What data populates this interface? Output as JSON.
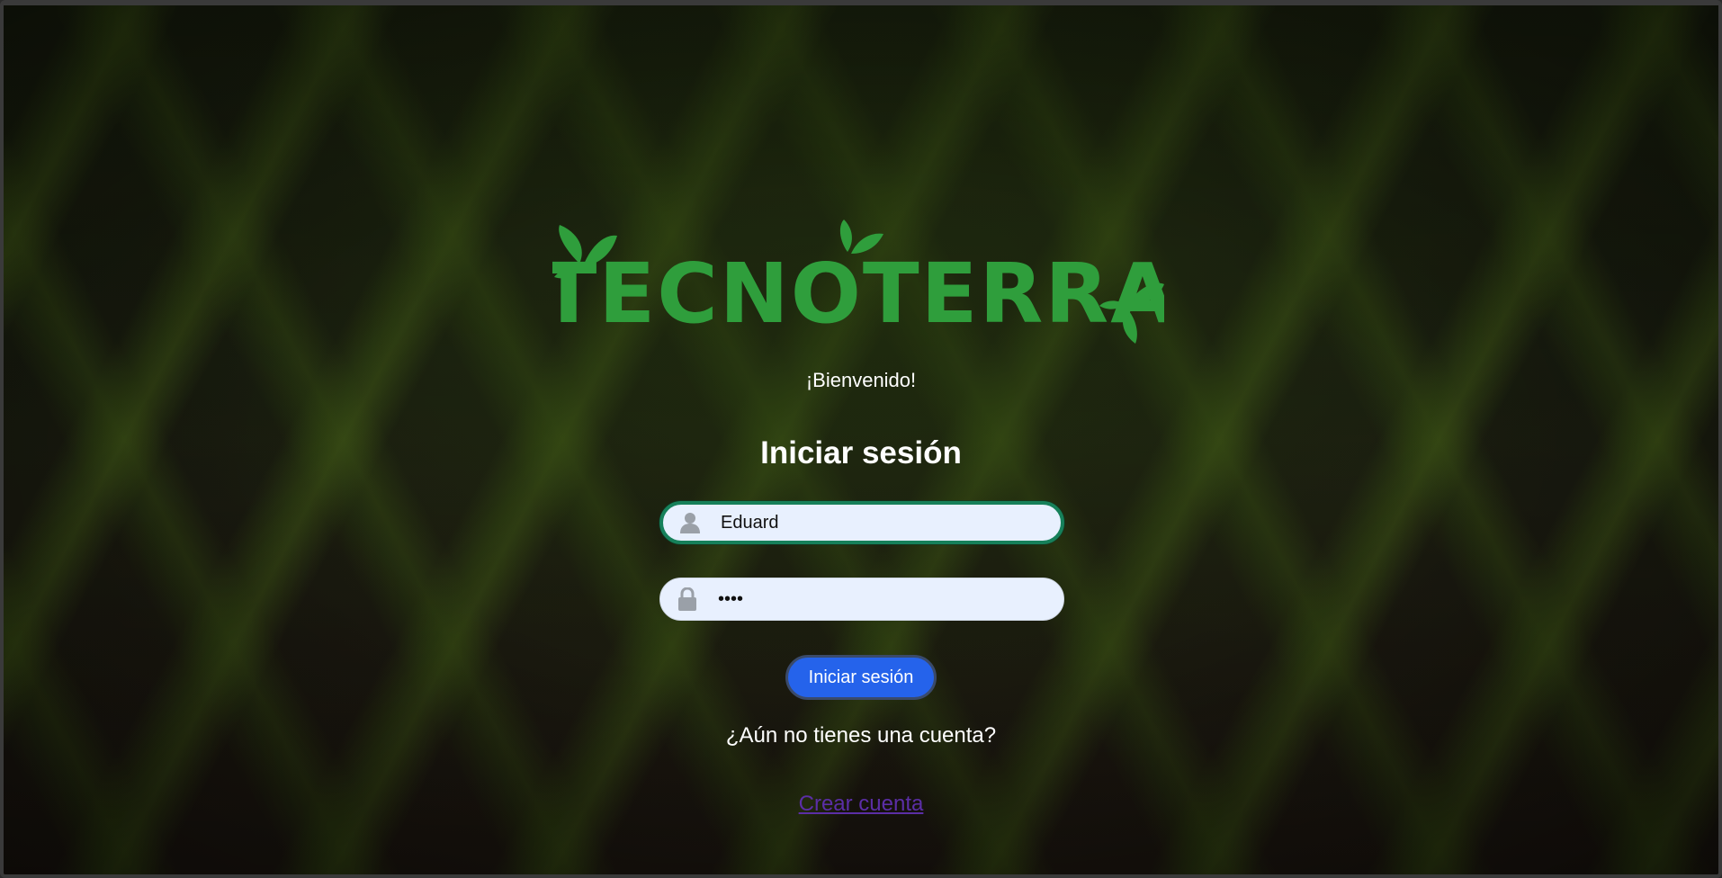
{
  "logo": {
    "text": "TECNOTERRA",
    "color": "#2f9e3c"
  },
  "welcome": "¡Bienvenido!",
  "form": {
    "title": "Iniciar sesión",
    "username": {
      "value": "Eduard",
      "icon": "user-icon"
    },
    "password": {
      "value": "••••",
      "icon": "lock-icon"
    },
    "submit_label": "Iniciar sesión"
  },
  "signup": {
    "prompt": "¿Aún no tienes una cuenta?",
    "link_label": "Crear cuenta"
  },
  "colors": {
    "accent_button": "#2563eb",
    "focus_border": "#16805a",
    "input_bg": "#e8f0fe",
    "link": "#5b2ea6"
  }
}
